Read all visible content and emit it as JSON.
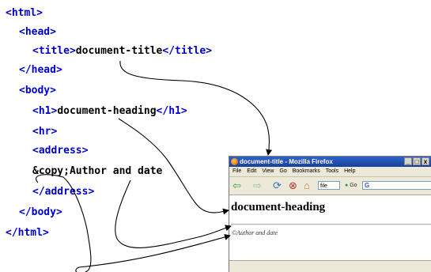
{
  "code_lines": [
    {
      "open": "<html>",
      "text": "",
      "close": ""
    },
    {
      "open": "<head>",
      "text": "",
      "close": ""
    },
    {
      "open": "<title>",
      "text": "document-title",
      "close": "</title>"
    },
    {
      "open": "</head>",
      "text": "",
      "close": ""
    },
    {
      "open": "<body>",
      "text": "",
      "close": ""
    },
    {
      "open": "<h1>",
      "text": "document-heading",
      "close": "</h1>"
    },
    {
      "open": "<hr>",
      "text": "",
      "close": ""
    },
    {
      "open": "<address>",
      "text": "",
      "close": ""
    },
    {
      "open": "",
      "text": "&copy;Author and date",
      "close": ""
    },
    {
      "open": "</address>",
      "text": "",
      "close": ""
    },
    {
      "open": "</body>",
      "text": "",
      "close": ""
    },
    {
      "open": "</html>",
      "text": "",
      "close": ""
    }
  ],
  "browser": {
    "window_title": "document-title - Mozilla Firefox",
    "window_buttons": [
      "_",
      "□",
      "x"
    ],
    "menu": [
      "File",
      "Edit",
      "View",
      "Go",
      "Bookmarks",
      "Tools",
      "Help"
    ],
    "location": "file",
    "go_label": "Go",
    "search_value": "G",
    "heading": "document-heading",
    "address": "©Author and date"
  },
  "colors": {
    "tag": "#0000cc",
    "text": "#000000",
    "titlebar": "#2456b8"
  }
}
